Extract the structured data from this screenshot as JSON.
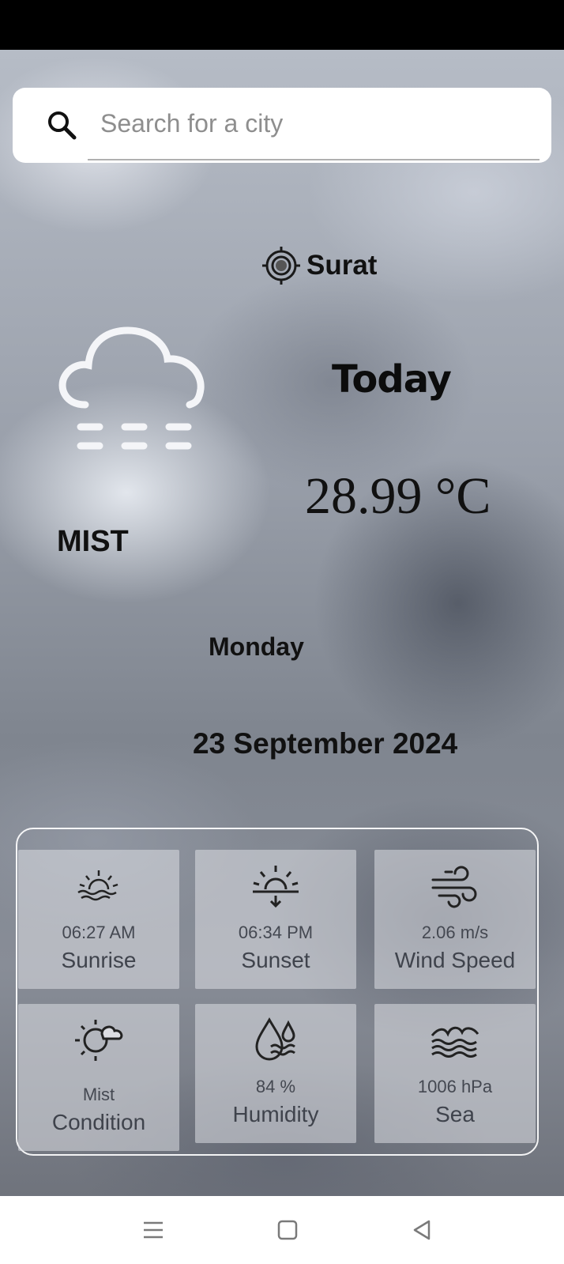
{
  "search": {
    "placeholder": "Search for a city",
    "value": ""
  },
  "location": {
    "city": "Surat"
  },
  "weather": {
    "heading": "Today",
    "temperature": "28.99 °C",
    "condition_main": "MIST",
    "day": "Monday",
    "date": "23 September 2024"
  },
  "details": [
    {
      "value": "06:27 AM",
      "label": "Sunrise",
      "icon": "sunrise-icon"
    },
    {
      "value": "06:34 PM",
      "label": "Sunset",
      "icon": "sunset-icon"
    },
    {
      "value": "2.06 m/s",
      "label": "Wind Speed",
      "icon": "wind-icon"
    },
    {
      "value": "Mist",
      "label": "Condition",
      "icon": "partly-cloudy-icon"
    },
    {
      "value": "84 %",
      "label": "Humidity",
      "icon": "humidity-icon"
    },
    {
      "value": "1006 hPa",
      "label": "Sea",
      "icon": "waves-icon"
    }
  ],
  "nav": {
    "menu": "menu-icon",
    "home": "home-icon",
    "back": "back-icon"
  }
}
